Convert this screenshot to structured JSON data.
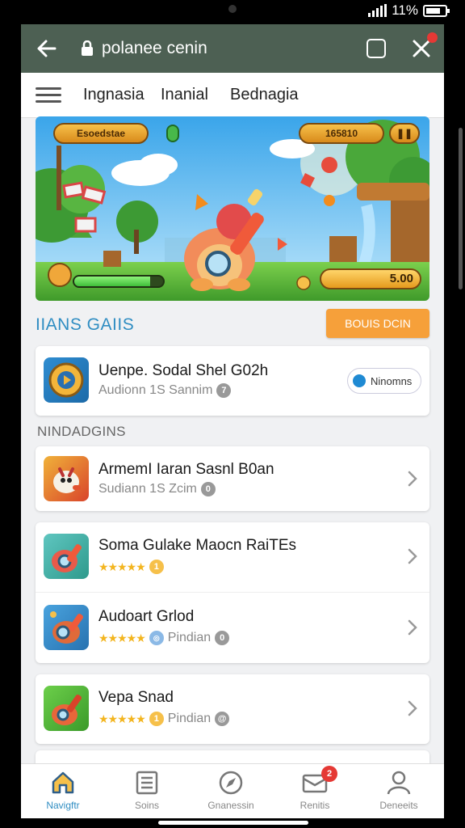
{
  "status": {
    "battery": "11%"
  },
  "browser": {
    "url": "polanee cenin",
    "tab_count": ""
  },
  "nav": {
    "tabs": [
      "Ingnasia",
      "Inanial",
      "Bednagia"
    ]
  },
  "banner": {
    "top_left_pill": "Esoedstae",
    "top_right_pill": "165810",
    "score": "5.00",
    "hp_level": 0.85
  },
  "section": {
    "title": "IIANS GAIIS",
    "button": "BOUIS DCIN"
  },
  "featured": {
    "name": "Uenpe. Sodal Shel G02h",
    "sub": "Audionn 1S Sannim",
    "badge": "7",
    "button": "Ninomns"
  },
  "subheader": "NINDADGINS",
  "items": [
    {
      "name": "ArmemI Iaran Sasnl B0an",
      "sub": "Sudiann 1S Zcim",
      "badge": "0",
      "stars": ""
    },
    {
      "name": "Soma Gulake Maocn RaiTEs",
      "sub": "",
      "badge": "1",
      "stars": "★★★★★"
    },
    {
      "name": "Audoart Grlod",
      "sub": "Pindian",
      "badge": "0",
      "stars": "★★★★★"
    },
    {
      "name": "Vepa Snad",
      "sub": "Pindian",
      "badge": "1",
      "stars": "★★★★★"
    }
  ],
  "bottom_nav": [
    {
      "label": "Navigftr",
      "icon": "home-icon"
    },
    {
      "label": "Soins",
      "icon": "list-icon"
    },
    {
      "label": "Gnanessin",
      "icon": "compass-icon"
    },
    {
      "label": "Renitis",
      "icon": "inbox-icon",
      "badge": "2"
    },
    {
      "label": "Deneeits",
      "icon": "profile-icon"
    }
  ],
  "colors": {
    "accent": "#2f8dc2",
    "toolbar": "#4d6053",
    "orange": "#f6a03a"
  }
}
